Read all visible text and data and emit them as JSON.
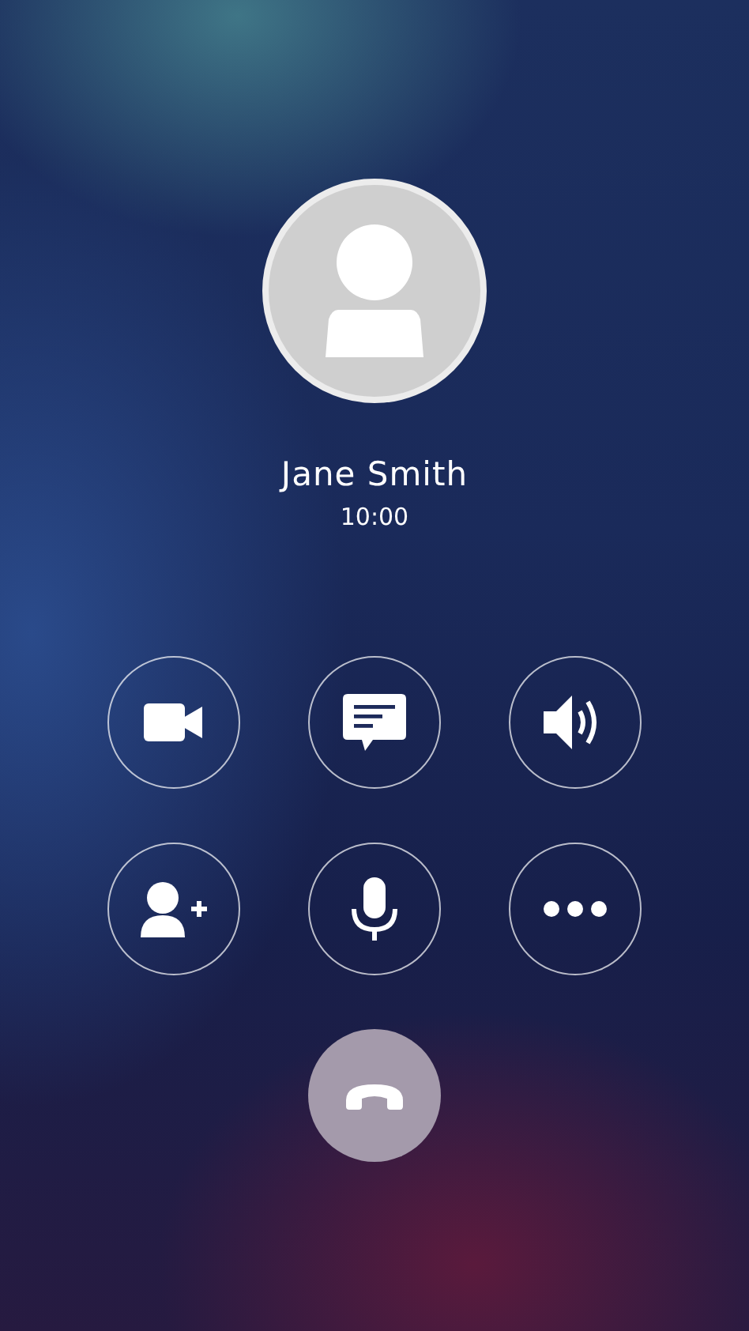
{
  "caller": {
    "name": "Jane Smith",
    "duration": "10:00"
  },
  "controls": [
    {
      "kind": "video"
    },
    {
      "kind": "message"
    },
    {
      "kind": "speaker"
    },
    {
      "kind": "add-contact"
    },
    {
      "kind": "mic"
    },
    {
      "kind": "more"
    }
  ],
  "end_call": {
    "kind": "hangup"
  }
}
